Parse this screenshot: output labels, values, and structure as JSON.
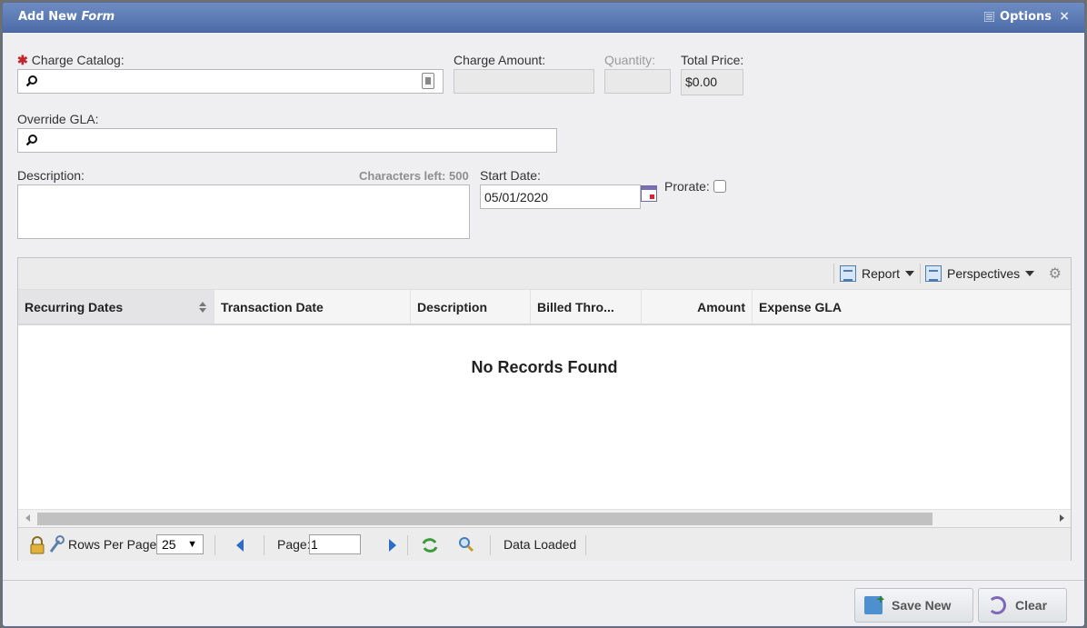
{
  "dialog": {
    "title_prefix": "Add New ",
    "title_italic": "Form",
    "options_label": "Options",
    "close_label": "×"
  },
  "form": {
    "charge_catalog_label": "Charge Catalog:",
    "required_marker": "✱",
    "charge_amount_label": "Charge Amount:",
    "quantity_label": "Quantity:",
    "total_price_label": "Total Price:",
    "total_price_value": "$0.00",
    "override_gla_label": "Override GLA:",
    "description_label": "Description:",
    "characters_left": "Characters left: 500",
    "start_date_label": "Start Date:",
    "start_date_value": "05/01/2020",
    "prorate_label": "Prorate:"
  },
  "grid": {
    "toolbar": {
      "report_label": "Report",
      "perspectives_label": "Perspectives"
    },
    "columns": [
      "Recurring Dates",
      "Transaction Date",
      "Description",
      "Billed Thro...",
      "Amount",
      "Expense GLA"
    ],
    "empty_text": "No Records Found",
    "pager": {
      "rows_per_page_label": "Rows Per Page:",
      "rows_per_page_value": "25",
      "page_label": "Page:",
      "page_value": "1",
      "status": "Data Loaded"
    }
  },
  "footer": {
    "save_new_label": "Save New",
    "clear_label": "Clear"
  },
  "colors": {
    "titlebar": "#4d6da8",
    "required": "#c0272d",
    "pager_arrows": "#2f6cc4"
  }
}
